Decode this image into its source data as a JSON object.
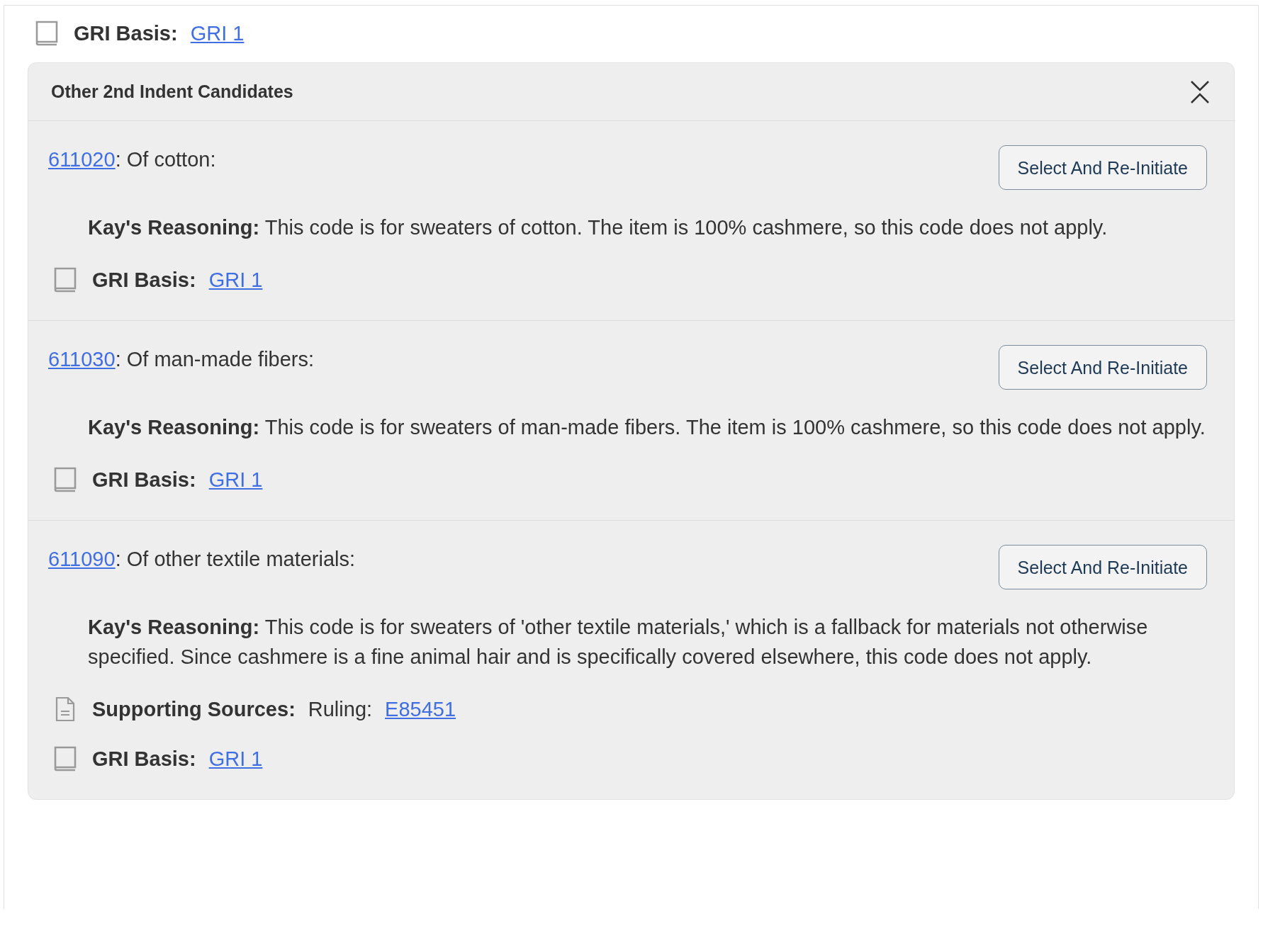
{
  "gri_basis": {
    "label": "GRI Basis:",
    "link": "GRI 1"
  },
  "panel": {
    "title": "Other 2nd Indent Candidates",
    "expanded": true,
    "candidates": [
      {
        "code": "611020",
        "description": ": Of cotton:",
        "button": "Select And Re-Initiate",
        "reasoning_label": "Kay's Reasoning:",
        "reasoning": "This code is for sweaters of cotton. The item is 100% cashmere, so this code does not apply.",
        "gri_basis": {
          "label": "GRI Basis:",
          "link": "GRI 1"
        }
      },
      {
        "code": "611030",
        "description": ": Of man-made fibers:",
        "button": "Select And Re-Initiate",
        "reasoning_label": "Kay's Reasoning:",
        "reasoning": "This code is for sweaters of man-made fibers. The item is 100% cashmere, so this code does not apply.",
        "gri_basis": {
          "label": "GRI Basis:",
          "link": "GRI 1"
        }
      },
      {
        "code": "611090",
        "description": ": Of other textile materials:",
        "button": "Select And Re-Initiate",
        "reasoning_label": "Kay's Reasoning:",
        "reasoning": "This code is for sweaters of 'other textile materials,' which is a fallback for materials not otherwise specified. Since cashmere is a fine animal hair and is specifically covered elsewhere, this code does not apply.",
        "supporting_sources": {
          "label": "Supporting Sources:",
          "source_label": "Ruling:",
          "link": "E85451"
        },
        "gri_basis": {
          "label": "GRI Basis:",
          "link": "GRI 1"
        }
      }
    ]
  }
}
